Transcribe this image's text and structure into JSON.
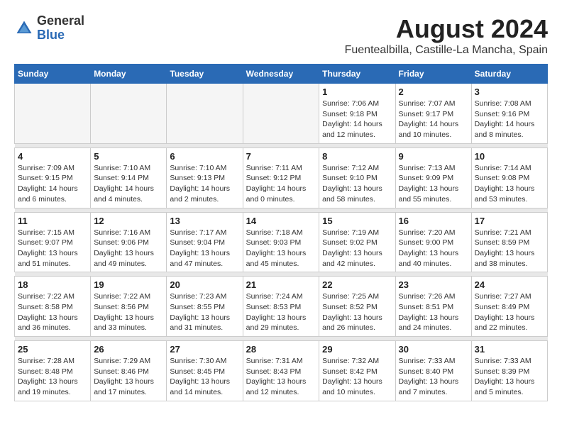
{
  "logo": {
    "general": "General",
    "blue": "Blue"
  },
  "title": "August 2024",
  "subtitle": "Fuentealbilla, Castille-La Mancha, Spain",
  "days_of_week": [
    "Sunday",
    "Monday",
    "Tuesday",
    "Wednesday",
    "Thursday",
    "Friday",
    "Saturday"
  ],
  "weeks": [
    {
      "days": [
        {
          "num": "",
          "info": ""
        },
        {
          "num": "",
          "info": ""
        },
        {
          "num": "",
          "info": ""
        },
        {
          "num": "",
          "info": ""
        },
        {
          "num": "1",
          "sunrise": "7:06 AM",
          "sunset": "9:18 PM",
          "daylight": "14 hours and 12 minutes."
        },
        {
          "num": "2",
          "sunrise": "7:07 AM",
          "sunset": "9:17 PM",
          "daylight": "14 hours and 10 minutes."
        },
        {
          "num": "3",
          "sunrise": "7:08 AM",
          "sunset": "9:16 PM",
          "daylight": "14 hours and 8 minutes."
        }
      ]
    },
    {
      "days": [
        {
          "num": "4",
          "sunrise": "7:09 AM",
          "sunset": "9:15 PM",
          "daylight": "14 hours and 6 minutes."
        },
        {
          "num": "5",
          "sunrise": "7:10 AM",
          "sunset": "9:14 PM",
          "daylight": "14 hours and 4 minutes."
        },
        {
          "num": "6",
          "sunrise": "7:10 AM",
          "sunset": "9:13 PM",
          "daylight": "14 hours and 2 minutes."
        },
        {
          "num": "7",
          "sunrise": "7:11 AM",
          "sunset": "9:12 PM",
          "daylight": "14 hours and 0 minutes."
        },
        {
          "num": "8",
          "sunrise": "7:12 AM",
          "sunset": "9:10 PM",
          "daylight": "13 hours and 58 minutes."
        },
        {
          "num": "9",
          "sunrise": "7:13 AM",
          "sunset": "9:09 PM",
          "daylight": "13 hours and 55 minutes."
        },
        {
          "num": "10",
          "sunrise": "7:14 AM",
          "sunset": "9:08 PM",
          "daylight": "13 hours and 53 minutes."
        }
      ]
    },
    {
      "days": [
        {
          "num": "11",
          "sunrise": "7:15 AM",
          "sunset": "9:07 PM",
          "daylight": "13 hours and 51 minutes."
        },
        {
          "num": "12",
          "sunrise": "7:16 AM",
          "sunset": "9:06 PM",
          "daylight": "13 hours and 49 minutes."
        },
        {
          "num": "13",
          "sunrise": "7:17 AM",
          "sunset": "9:04 PM",
          "daylight": "13 hours and 47 minutes."
        },
        {
          "num": "14",
          "sunrise": "7:18 AM",
          "sunset": "9:03 PM",
          "daylight": "13 hours and 45 minutes."
        },
        {
          "num": "15",
          "sunrise": "7:19 AM",
          "sunset": "9:02 PM",
          "daylight": "13 hours and 42 minutes."
        },
        {
          "num": "16",
          "sunrise": "7:20 AM",
          "sunset": "9:00 PM",
          "daylight": "13 hours and 40 minutes."
        },
        {
          "num": "17",
          "sunrise": "7:21 AM",
          "sunset": "8:59 PM",
          "daylight": "13 hours and 38 minutes."
        }
      ]
    },
    {
      "days": [
        {
          "num": "18",
          "sunrise": "7:22 AM",
          "sunset": "8:58 PM",
          "daylight": "13 hours and 36 minutes."
        },
        {
          "num": "19",
          "sunrise": "7:22 AM",
          "sunset": "8:56 PM",
          "daylight": "13 hours and 33 minutes."
        },
        {
          "num": "20",
          "sunrise": "7:23 AM",
          "sunset": "8:55 PM",
          "daylight": "13 hours and 31 minutes."
        },
        {
          "num": "21",
          "sunrise": "7:24 AM",
          "sunset": "8:53 PM",
          "daylight": "13 hours and 29 minutes."
        },
        {
          "num": "22",
          "sunrise": "7:25 AM",
          "sunset": "8:52 PM",
          "daylight": "13 hours and 26 minutes."
        },
        {
          "num": "23",
          "sunrise": "7:26 AM",
          "sunset": "8:51 PM",
          "daylight": "13 hours and 24 minutes."
        },
        {
          "num": "24",
          "sunrise": "7:27 AM",
          "sunset": "8:49 PM",
          "daylight": "13 hours and 22 minutes."
        }
      ]
    },
    {
      "days": [
        {
          "num": "25",
          "sunrise": "7:28 AM",
          "sunset": "8:48 PM",
          "daylight": "13 hours and 19 minutes."
        },
        {
          "num": "26",
          "sunrise": "7:29 AM",
          "sunset": "8:46 PM",
          "daylight": "13 hours and 17 minutes."
        },
        {
          "num": "27",
          "sunrise": "7:30 AM",
          "sunset": "8:45 PM",
          "daylight": "13 hours and 14 minutes."
        },
        {
          "num": "28",
          "sunrise": "7:31 AM",
          "sunset": "8:43 PM",
          "daylight": "13 hours and 12 minutes."
        },
        {
          "num": "29",
          "sunrise": "7:32 AM",
          "sunset": "8:42 PM",
          "daylight": "13 hours and 10 minutes."
        },
        {
          "num": "30",
          "sunrise": "7:33 AM",
          "sunset": "8:40 PM",
          "daylight": "13 hours and 7 minutes."
        },
        {
          "num": "31",
          "sunrise": "7:33 AM",
          "sunset": "8:39 PM",
          "daylight": "13 hours and 5 minutes."
        }
      ]
    }
  ],
  "labels": {
    "sunrise": "Sunrise:",
    "sunset": "Sunset:",
    "daylight": "Daylight:"
  }
}
